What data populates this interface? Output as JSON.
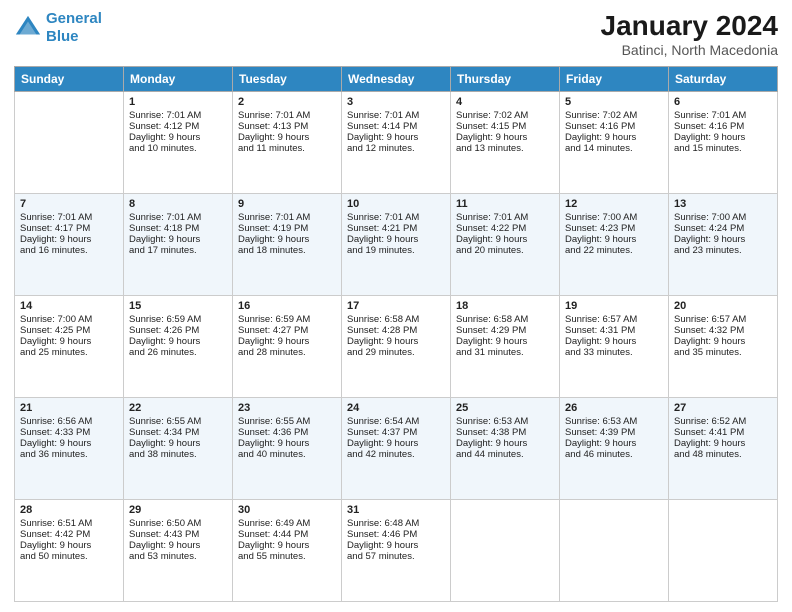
{
  "header": {
    "logo_line1": "General",
    "logo_line2": "Blue",
    "title": "January 2024",
    "subtitle": "Batinci, North Macedonia"
  },
  "columns": [
    "Sunday",
    "Monday",
    "Tuesday",
    "Wednesday",
    "Thursday",
    "Friday",
    "Saturday"
  ],
  "weeks": [
    [
      {
        "day": "",
        "info": ""
      },
      {
        "day": "1",
        "info": "Sunrise: 7:01 AM\nSunset: 4:12 PM\nDaylight: 9 hours\nand 10 minutes."
      },
      {
        "day": "2",
        "info": "Sunrise: 7:01 AM\nSunset: 4:13 PM\nDaylight: 9 hours\nand 11 minutes."
      },
      {
        "day": "3",
        "info": "Sunrise: 7:01 AM\nSunset: 4:14 PM\nDaylight: 9 hours\nand 12 minutes."
      },
      {
        "day": "4",
        "info": "Sunrise: 7:02 AM\nSunset: 4:15 PM\nDaylight: 9 hours\nand 13 minutes."
      },
      {
        "day": "5",
        "info": "Sunrise: 7:02 AM\nSunset: 4:16 PM\nDaylight: 9 hours\nand 14 minutes."
      },
      {
        "day": "6",
        "info": "Sunrise: 7:01 AM\nSunset: 4:16 PM\nDaylight: 9 hours\nand 15 minutes."
      }
    ],
    [
      {
        "day": "7",
        "info": "Sunrise: 7:01 AM\nSunset: 4:17 PM\nDaylight: 9 hours\nand 16 minutes."
      },
      {
        "day": "8",
        "info": "Sunrise: 7:01 AM\nSunset: 4:18 PM\nDaylight: 9 hours\nand 17 minutes."
      },
      {
        "day": "9",
        "info": "Sunrise: 7:01 AM\nSunset: 4:19 PM\nDaylight: 9 hours\nand 18 minutes."
      },
      {
        "day": "10",
        "info": "Sunrise: 7:01 AM\nSunset: 4:21 PM\nDaylight: 9 hours\nand 19 minutes."
      },
      {
        "day": "11",
        "info": "Sunrise: 7:01 AM\nSunset: 4:22 PM\nDaylight: 9 hours\nand 20 minutes."
      },
      {
        "day": "12",
        "info": "Sunrise: 7:00 AM\nSunset: 4:23 PM\nDaylight: 9 hours\nand 22 minutes."
      },
      {
        "day": "13",
        "info": "Sunrise: 7:00 AM\nSunset: 4:24 PM\nDaylight: 9 hours\nand 23 minutes."
      }
    ],
    [
      {
        "day": "14",
        "info": "Sunrise: 7:00 AM\nSunset: 4:25 PM\nDaylight: 9 hours\nand 25 minutes."
      },
      {
        "day": "15",
        "info": "Sunrise: 6:59 AM\nSunset: 4:26 PM\nDaylight: 9 hours\nand 26 minutes."
      },
      {
        "day": "16",
        "info": "Sunrise: 6:59 AM\nSunset: 4:27 PM\nDaylight: 9 hours\nand 28 minutes."
      },
      {
        "day": "17",
        "info": "Sunrise: 6:58 AM\nSunset: 4:28 PM\nDaylight: 9 hours\nand 29 minutes."
      },
      {
        "day": "18",
        "info": "Sunrise: 6:58 AM\nSunset: 4:29 PM\nDaylight: 9 hours\nand 31 minutes."
      },
      {
        "day": "19",
        "info": "Sunrise: 6:57 AM\nSunset: 4:31 PM\nDaylight: 9 hours\nand 33 minutes."
      },
      {
        "day": "20",
        "info": "Sunrise: 6:57 AM\nSunset: 4:32 PM\nDaylight: 9 hours\nand 35 minutes."
      }
    ],
    [
      {
        "day": "21",
        "info": "Sunrise: 6:56 AM\nSunset: 4:33 PM\nDaylight: 9 hours\nand 36 minutes."
      },
      {
        "day": "22",
        "info": "Sunrise: 6:55 AM\nSunset: 4:34 PM\nDaylight: 9 hours\nand 38 minutes."
      },
      {
        "day": "23",
        "info": "Sunrise: 6:55 AM\nSunset: 4:36 PM\nDaylight: 9 hours\nand 40 minutes."
      },
      {
        "day": "24",
        "info": "Sunrise: 6:54 AM\nSunset: 4:37 PM\nDaylight: 9 hours\nand 42 minutes."
      },
      {
        "day": "25",
        "info": "Sunrise: 6:53 AM\nSunset: 4:38 PM\nDaylight: 9 hours\nand 44 minutes."
      },
      {
        "day": "26",
        "info": "Sunrise: 6:53 AM\nSunset: 4:39 PM\nDaylight: 9 hours\nand 46 minutes."
      },
      {
        "day": "27",
        "info": "Sunrise: 6:52 AM\nSunset: 4:41 PM\nDaylight: 9 hours\nand 48 minutes."
      }
    ],
    [
      {
        "day": "28",
        "info": "Sunrise: 6:51 AM\nSunset: 4:42 PM\nDaylight: 9 hours\nand 50 minutes."
      },
      {
        "day": "29",
        "info": "Sunrise: 6:50 AM\nSunset: 4:43 PM\nDaylight: 9 hours\nand 53 minutes."
      },
      {
        "day": "30",
        "info": "Sunrise: 6:49 AM\nSunset: 4:44 PM\nDaylight: 9 hours\nand 55 minutes."
      },
      {
        "day": "31",
        "info": "Sunrise: 6:48 AM\nSunset: 4:46 PM\nDaylight: 9 hours\nand 57 minutes."
      },
      {
        "day": "",
        "info": ""
      },
      {
        "day": "",
        "info": ""
      },
      {
        "day": "",
        "info": ""
      }
    ]
  ]
}
